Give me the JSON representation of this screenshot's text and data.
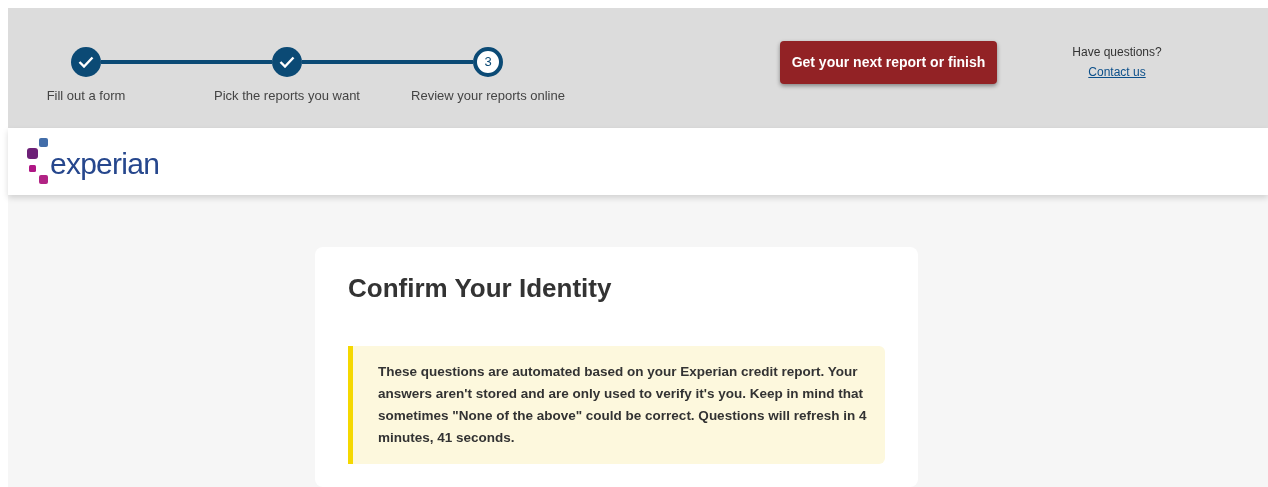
{
  "progress": {
    "steps": [
      {
        "label": "Fill out a form",
        "kind": "done"
      },
      {
        "label": "Pick the reports you want",
        "kind": "done"
      },
      {
        "label": "Review your reports online",
        "kind": "current",
        "number": "3"
      }
    ]
  },
  "header_button": {
    "label": "Get your next report or finish"
  },
  "help": {
    "question": "Have questions?",
    "link": "Contact us"
  },
  "logo": {
    "text": "experian"
  },
  "card": {
    "title": "Confirm Your Identity",
    "notice": "These questions are automated based on your Experian credit report. Your answers aren't stored and are only used to verify it's you. Keep in mind that sometimes \"None of the above\" could be correct. Questions will refresh in 4 minutes, 41 seconds."
  }
}
